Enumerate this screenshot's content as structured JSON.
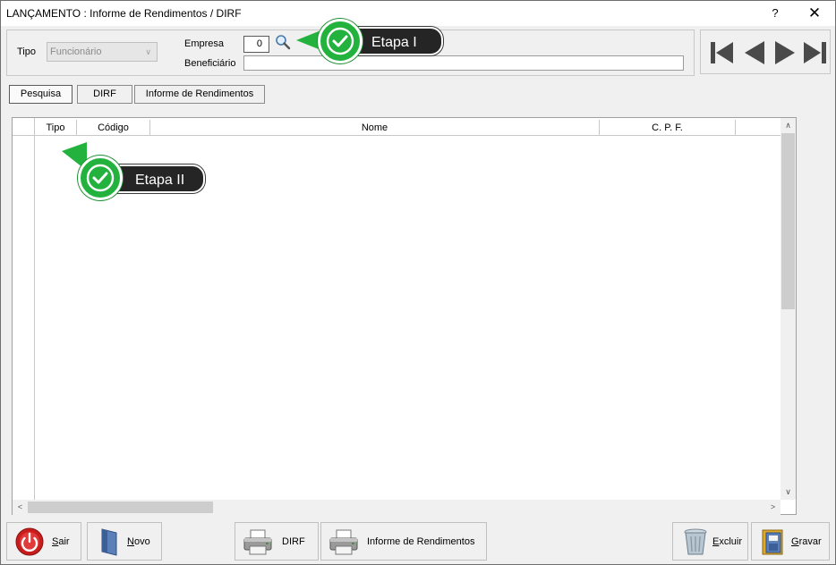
{
  "window": {
    "title": "LANÇAMENTO : Informe de Rendimentos / DIRF",
    "help": "?",
    "close": "✕"
  },
  "filters": {
    "tipo_label": "Tipo",
    "tipo_value": "Funcionário",
    "empresa_label": "Empresa",
    "empresa_value": "0",
    "beneficiario_label": "Beneficiário",
    "beneficiario_value": ""
  },
  "tabs": [
    {
      "label": "Pesquisa",
      "active": true
    },
    {
      "label": "DIRF",
      "active": false
    },
    {
      "label": "Informe de Rendimentos",
      "active": false
    }
  ],
  "grid": {
    "columns": [
      "Tipo",
      "Código",
      "Nome",
      "C. P. F."
    ],
    "rows": []
  },
  "buttons": {
    "sair": {
      "mnemonic": "S",
      "rest": "air"
    },
    "novo": {
      "mnemonic": "N",
      "rest": "ovo"
    },
    "dirf": "DIRF",
    "informe": "Informe de Rendimentos",
    "excluir": {
      "mnemonic": "E",
      "rest": "xcluir"
    },
    "gravar": {
      "mnemonic": "G",
      "rest": "ravar"
    }
  },
  "callouts": [
    "Etapa I",
    "Etapa II"
  ],
  "colors": {
    "accent_green": "#23b23d",
    "callout_dark": "#252525",
    "nav_gray": "#4a4a4a"
  }
}
